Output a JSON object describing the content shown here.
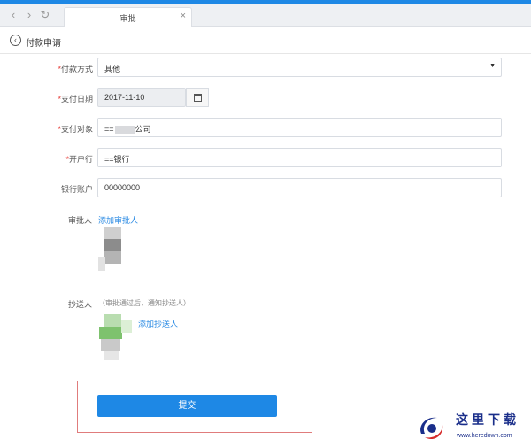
{
  "tab": {
    "title": "审批",
    "close": "×"
  },
  "header": {
    "title": "付款申请"
  },
  "form": {
    "payment_method": {
      "label": "付款方式",
      "value": "其他"
    },
    "pay_date": {
      "label": "支付日期",
      "value": "2017-11-10"
    },
    "pay_target": {
      "label": "支付对象",
      "value_prefix": "==",
      "value_suffix": "公司"
    },
    "bank": {
      "label": "开户行",
      "value": "==银行"
    },
    "account": {
      "label": "银行账户",
      "value": "00000000"
    },
    "approver": {
      "label": "审批人",
      "add_link": "添加审批人"
    },
    "cc": {
      "label": "抄送人",
      "hint": "（审批通过后，通知抄送人）",
      "add_link": "添加抄送人"
    },
    "required_mark": "*"
  },
  "submit": {
    "label": "提交"
  },
  "watermark": {
    "text": "这里下载",
    "url": "www.heredown.com"
  },
  "colors": {
    "accent": "#1e88e5",
    "link": "#2f8de4",
    "required": "#e53935"
  }
}
